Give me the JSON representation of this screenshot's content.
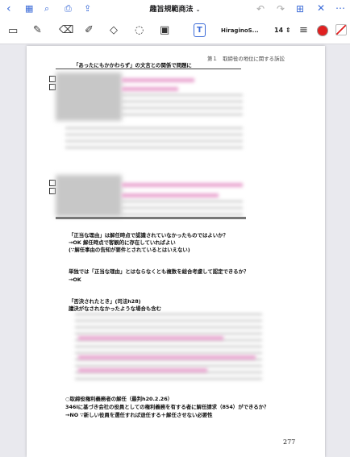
{
  "app": {
    "title": "趣旨規範商法",
    "font_name": "HiraginoS...",
    "font_size": "14",
    "accent": "#3b6bd8",
    "pen_color": "#e02020"
  },
  "icons": {
    "back": "chevron-left-icon",
    "grid": "grid-icon",
    "search": "search-icon",
    "bookmark": "bookmark-icon",
    "share": "share-icon",
    "undo": "undo-icon",
    "redo": "redo-icon",
    "add_page": "add-page-icon",
    "close": "close-icon",
    "more": "more-icon"
  },
  "page": {
    "header_right": "第１　取締役の地位に関する訴訟",
    "header_left": "「あったにもかかわらず」の文言との関係で問題に",
    "para1_l1": "「正当な理由」は解任時点で認識されていなかったものではよいか？",
    "para1_l2": "→OK 解任時点で客観的に存在していればよい",
    "para1_l3": "(∵解任事由の告知が要件とされているとはいえない)",
    "para2_l1": "単独では「正当な理由」とはならなくとも複数を総合考慮して認定できるか？",
    "para2_l2": "→OK",
    "para3_l1": "「否決されたとき」(司法h28)",
    "para3_l2": "議決がなされなかったような場合も含む",
    "para4_l1": "○取締役権利義務者の解任（最判h20.2.26）",
    "para4_l2": "346Ⅰに基づき会社の役員としての権利義務を有する者に解任請求（854）ができるか？",
    "para4_l3": "→NO ∵新しい役員を選任すれば退任する＋解任させない必要性",
    "page_number": "277"
  }
}
